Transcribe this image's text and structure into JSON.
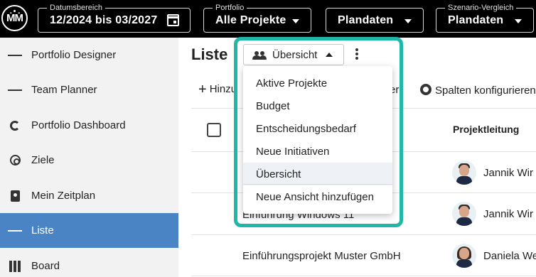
{
  "header": {
    "logo": "ṀṀ",
    "date_range": {
      "label": "Datumsbereich",
      "value": "12/2024 bis 03/2027",
      "icon": "calendar-icon"
    },
    "portfolio": {
      "label": "Portfolio",
      "value": "Alle Projekte"
    },
    "data_select": {
      "value": "Plandaten"
    },
    "scenario": {
      "label": "Szenario-Vergleich",
      "value": "Plandaten"
    }
  },
  "sidebar": {
    "items": [
      {
        "label": "Portfolio Designer",
        "icon": "portfolio-designer-icon"
      },
      {
        "label": "Team Planner",
        "icon": "team-planner-icon"
      },
      {
        "label": "Portfolio Dashboard",
        "icon": "dashboard-icon"
      },
      {
        "label": "Ziele",
        "icon": "target-icon"
      },
      {
        "label": "Mein Zeitplan",
        "icon": "badge-icon"
      },
      {
        "label": "Liste",
        "icon": "list-icon",
        "active": true
      },
      {
        "label": "Board",
        "icon": "board-icon"
      }
    ]
  },
  "main": {
    "title": "Liste",
    "view_button": {
      "label": "Übersicht"
    },
    "toolbar": {
      "add_label": "Hinzu",
      "export_label": "er",
      "columns_label": "Spalten konfigurieren"
    },
    "table": {
      "columns": {
        "project_lead": "Projektleitung"
      },
      "rows": [
        {
          "project": "",
          "lead": "Jannik Wir"
        },
        {
          "project": "Einführung Windows 11",
          "lead": "Jannik Wir"
        },
        {
          "project": "Einführungsprojekt Muster GmbH",
          "lead": "Daniela We"
        }
      ]
    }
  },
  "view_menu": {
    "items": [
      "Aktive Projekte",
      "Budget",
      "Entscheidungsbedarf",
      "Neue Initiativen",
      "Übersicht"
    ],
    "selected": "Übersicht",
    "add_view": "Neue Ansicht hinzufügen"
  },
  "colors": {
    "topbar": "#000000",
    "sidebar_bg": "#f2f2f2",
    "active_nav": "#4a84c4",
    "highlight_frame": "#1fb8a8"
  }
}
